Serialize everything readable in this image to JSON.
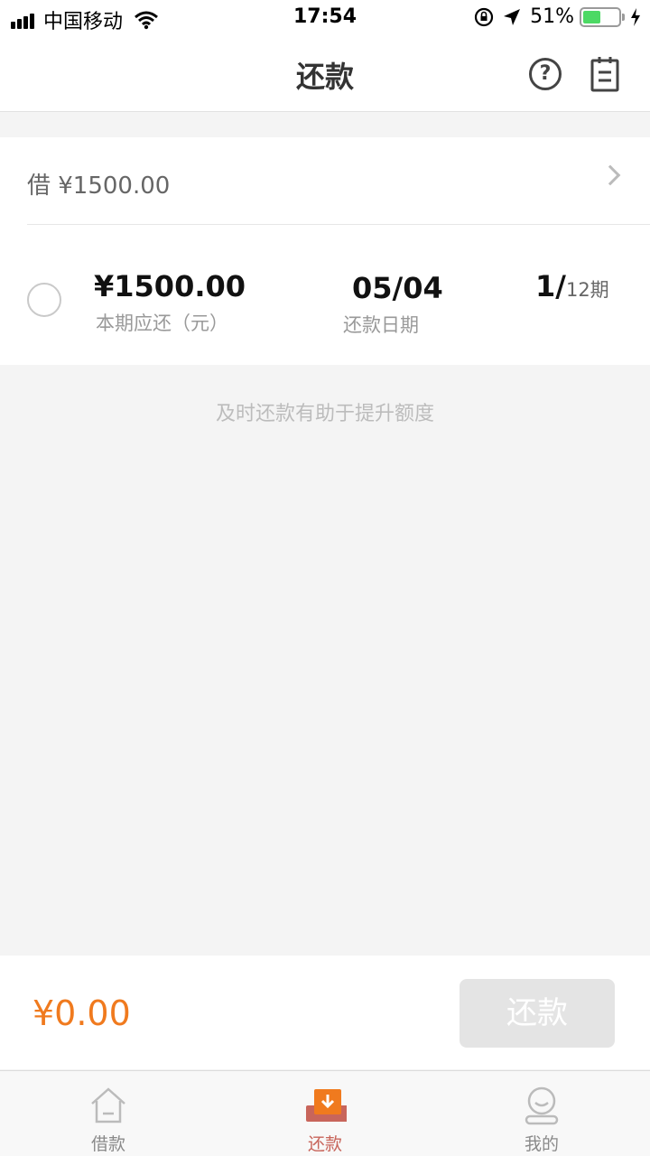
{
  "status_bar": {
    "carrier": "中国移动",
    "time": "17:54",
    "battery": "51%"
  },
  "nav": {
    "title": "还款",
    "help_glyph": "?",
    "icons": [
      "help-icon",
      "record-icon"
    ]
  },
  "loan": {
    "header_label": "借 ¥1500.00",
    "amount": "¥1500.00",
    "amount_label": "本期应还（元）",
    "date": "05/04",
    "date_label": "还款日期",
    "period_current": "1/",
    "period_total": "12期"
  },
  "hint": "及时还款有助于提升额度",
  "pay_bar": {
    "total": "¥0.00",
    "button_label": "还款"
  },
  "tabs": [
    {
      "label": "借款",
      "icon": "house-icon"
    },
    {
      "label": "还款",
      "icon": "repay-icon"
    },
    {
      "label": "我的",
      "icon": "profile-icon"
    }
  ],
  "colors": {
    "accent": "#f07a1e",
    "active_tab": "#c8655b",
    "battery": "#4cd964",
    "disabled_button": "#e4e4e4"
  }
}
